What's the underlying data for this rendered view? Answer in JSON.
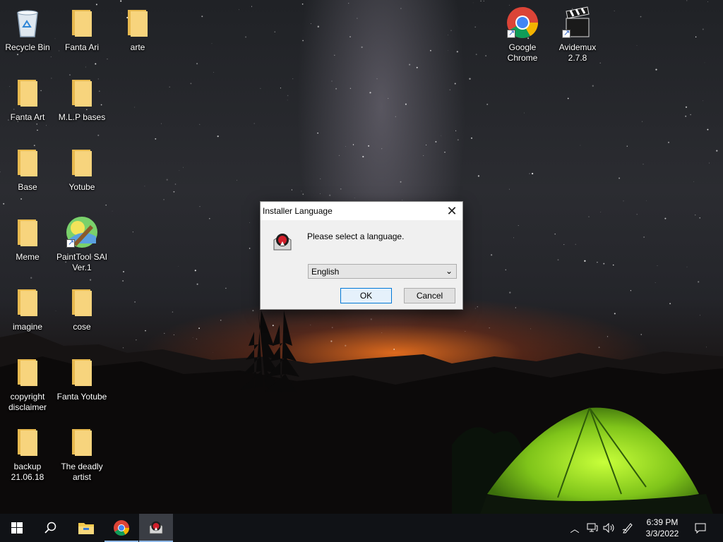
{
  "desktop": {
    "icons": [
      {
        "label": "Recycle Bin",
        "type": "recycle"
      },
      {
        "label": "Fanta Ari",
        "type": "folder"
      },
      {
        "label": "arte",
        "type": "folder"
      },
      {
        "label": "Fanta Art",
        "type": "folder"
      },
      {
        "label": "M.L.P bases",
        "type": "folder"
      },
      {
        "label": "Base",
        "type": "folder"
      },
      {
        "label": "Yotube",
        "type": "folder"
      },
      {
        "label": "Meme",
        "type": "folder"
      },
      {
        "label": "PaintTool SAI\nVer.1",
        "type": "paintsai"
      },
      {
        "label": "imagine",
        "type": "folder"
      },
      {
        "label": "cose",
        "type": "folder"
      },
      {
        "label": "copyright\ndisclaimer",
        "type": "folder"
      },
      {
        "label": "Fanta Yotube",
        "type": "folder"
      },
      {
        "label": "backup\n21.06.18",
        "type": "folder"
      },
      {
        "label": "The deadly\nartist",
        "type": "folder"
      },
      {
        "label": "Google\nChrome",
        "type": "chrome"
      },
      {
        "label": "Avidemux\n2.7.8",
        "type": "avidemux"
      }
    ]
  },
  "dialog": {
    "title": "Installer Language",
    "prompt": "Please select a language.",
    "language_selected": "English",
    "ok_label": "OK",
    "cancel_label": "Cancel"
  },
  "taskbar": {
    "time": "6:39 PM",
    "date": "3/3/2022"
  },
  "colors": {
    "folder": "#f3d27a",
    "taskbar": "#101216",
    "accent": "#0078d7"
  }
}
